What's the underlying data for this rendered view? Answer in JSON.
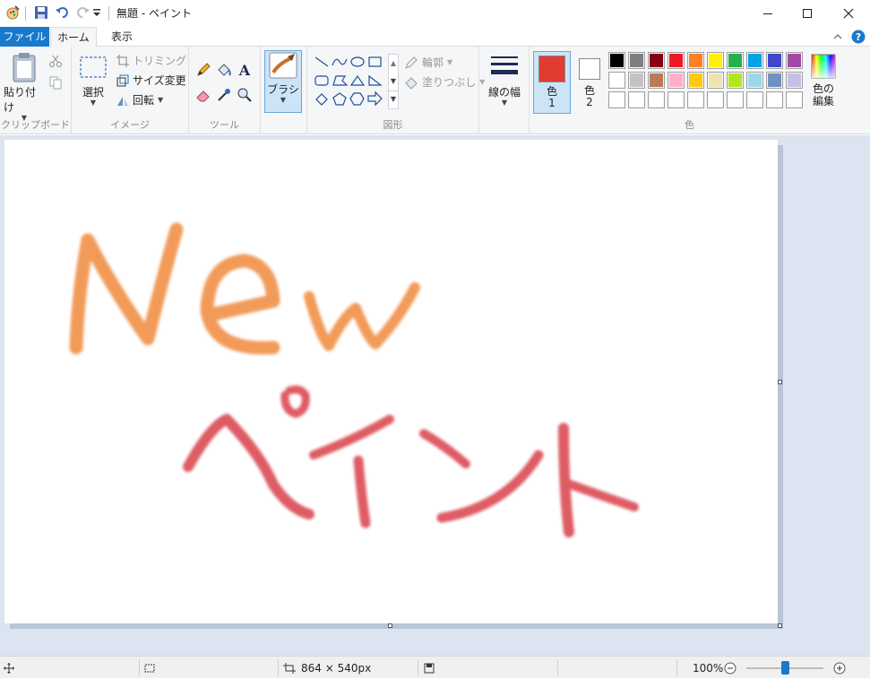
{
  "window": {
    "title": "無題 - ペイント",
    "quick_access": [
      "paint-app-icon",
      "save-icon",
      "undo-icon",
      "redo-icon",
      "customize-qat-icon"
    ],
    "controls": [
      "minimize-icon",
      "maximize-icon",
      "close-icon"
    ]
  },
  "tabs": [
    {
      "label": "ファイル",
      "active": false
    },
    {
      "label": "ホーム",
      "active": true
    },
    {
      "label": "表示",
      "active": false
    }
  ],
  "ribbon": {
    "clipboard": {
      "group_label": "クリップボード",
      "paste_label": "貼り付け"
    },
    "image": {
      "group_label": "イメージ",
      "select_label": "選択",
      "crop_label": "トリミング",
      "resize_label": "サイズ変更",
      "rotate_label": "回転"
    },
    "tools": {
      "group_label": "ツール"
    },
    "brushes": {
      "label": "ブラシ"
    },
    "shapes": {
      "group_label": "図形",
      "outline_label": "輪郭",
      "fill_label": "塗りつぶし"
    },
    "size": {
      "label": "線の幅"
    },
    "colors": {
      "group_label": "色",
      "color1_label": "色",
      "color1_num": "1",
      "color2_label": "色",
      "color2_num": "2",
      "edit_label_1": "色の",
      "edit_label_2": "編集",
      "color1_value": "#e03c31",
      "color2_value": "#ffffff",
      "palette_row1": [
        "#000000",
        "#7f7f7f",
        "#880015",
        "#ed1c24",
        "#ff7f27",
        "#fff200",
        "#22b14c",
        "#00a2e8",
        "#3f48cc",
        "#a349a4"
      ],
      "palette_row2": [
        "#ffffff",
        "#c3c3c3",
        "#b97a57",
        "#ffaec9",
        "#ffc90e",
        "#efe4b0",
        "#b5e61d",
        "#99d9ea",
        "#7092be",
        "#c8bfe7"
      ],
      "palette_row3": [
        "#ffffff",
        "#ffffff",
        "#ffffff",
        "#ffffff",
        "#ffffff",
        "#ffffff",
        "#ffffff",
        "#ffffff",
        "#ffffff",
        "#ffffff"
      ]
    }
  },
  "canvas": {
    "drawing_text_1": "New",
    "drawing_text_2": "ペイント",
    "color_text_1": "#f08a3c",
    "color_text_2": "#d9404a"
  },
  "status": {
    "canvas_size": "864 × 540px",
    "zoom": "100%",
    "zoom_level": 0.5
  }
}
